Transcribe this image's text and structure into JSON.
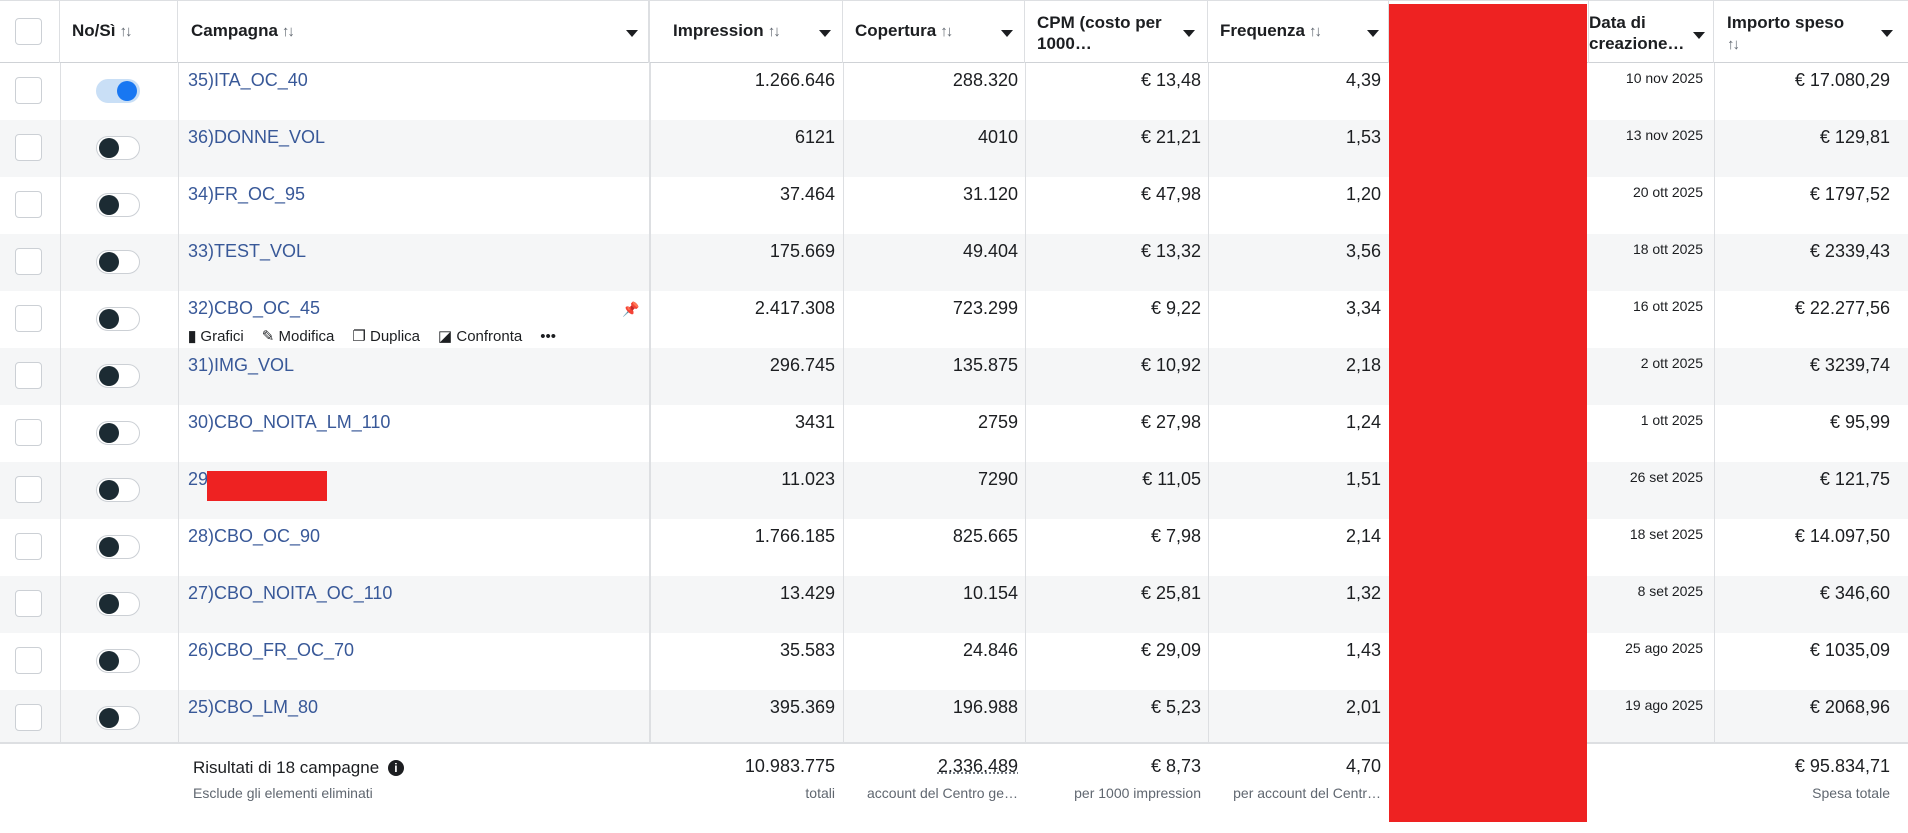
{
  "header": {
    "col_toggle": "No/Sì",
    "col_campaign": "Campagna",
    "col_impressions": "Impression",
    "col_reach": "Copertura",
    "col_cpm": "CPM (costo per 1000…",
    "col_frequency": "Frequenza",
    "col_date": "Data di creazione…",
    "col_spent": "Importo speso",
    "sort_glyph": "↑↓"
  },
  "row_actions": {
    "charts": "Grafici",
    "edit": "Modifica",
    "duplicate": "Duplica",
    "compare": "Confronta",
    "more": "•••"
  },
  "rows": [
    {
      "name": "35)ITA_OC_40",
      "on": true,
      "impressions": "1.266.646",
      "reach": "288.320",
      "cpm": "€ 13,48",
      "frequency": "4,39",
      "date": "10 nov 2025",
      "spent": "€ 17.080,29"
    },
    {
      "name": "36)DONNE_VOL",
      "on": false,
      "impressions": "6121",
      "reach": "4010",
      "cpm": "€ 21,21",
      "frequency": "1,53",
      "date": "13 nov 2025",
      "spent": "€ 129,81"
    },
    {
      "name": "34)FR_OC_95",
      "on": false,
      "impressions": "37.464",
      "reach": "31.120",
      "cpm": "€ 47,98",
      "frequency": "1,20",
      "date": "20 ott 2025",
      "spent": "€ 1797,52"
    },
    {
      "name": "33)TEST_VOL",
      "on": false,
      "impressions": "175.669",
      "reach": "49.404",
      "cpm": "€ 13,32",
      "frequency": "3,56",
      "date": "18 ott 2025",
      "spent": "€ 2339,43"
    },
    {
      "name": "32)CBO_OC_45",
      "on": false,
      "impressions": "2.417.308",
      "reach": "723.299",
      "cpm": "€ 9,22",
      "frequency": "3,34",
      "date": "16 ott 2025",
      "spent": "€ 22.277,56"
    },
    {
      "name": "31)IMG_VOL",
      "on": false,
      "impressions": "296.745",
      "reach": "135.875",
      "cpm": "€ 10,92",
      "frequency": "2,18",
      "date": "2 ott 2025",
      "spent": "€ 3239,74"
    },
    {
      "name": "30)CBO_NOITA_LM_110",
      "on": false,
      "impressions": "3431",
      "reach": "2759",
      "cpm": "€ 27,98",
      "frequency": "1,24",
      "date": "1 ott 2025",
      "spent": "€ 95,99"
    },
    {
      "name": "29",
      "on": false,
      "impressions": "11.023",
      "reach": "7290",
      "cpm": "€ 11,05",
      "frequency": "1,51",
      "date": "26 set 2025",
      "spent": "€ 121,75"
    },
    {
      "name": "28)CBO_OC_90",
      "on": false,
      "impressions": "1.766.185",
      "reach": "825.665",
      "cpm": "€ 7,98",
      "frequency": "2,14",
      "date": "18 set 2025",
      "spent": "€ 14.097,50"
    },
    {
      "name": "27)CBO_NOITA_OC_110",
      "on": false,
      "impressions": "13.429",
      "reach": "10.154",
      "cpm": "€ 25,81",
      "frequency": "1,32",
      "date": "8 set 2025",
      "spent": "€ 346,60"
    },
    {
      "name": "26)CBO_FR_OC_70",
      "on": false,
      "impressions": "35.583",
      "reach": "24.846",
      "cpm": "€ 29,09",
      "frequency": "1,43",
      "date": "25 ago 2025",
      "spent": "€ 1035,09"
    },
    {
      "name": "25)CBO_LM_80",
      "on": false,
      "impressions": "395.369",
      "reach": "196.988",
      "cpm": "€ 5,23",
      "frequency": "2,01",
      "date": "19 ago 2025",
      "spent": "€ 2068,96"
    }
  ],
  "footer": {
    "title": "Risultati di 18 campagne",
    "info_icon": "i",
    "subtitle": "Esclude gli elementi eliminati",
    "impressions": "10.983.775",
    "impressions_sub": "totali",
    "reach": "2.336.489",
    "reach_sub": "account del Centro ge…",
    "cpm": "€ 8,73",
    "cpm_sub": "per 1000 impression",
    "frequency": "4,70",
    "frequency_sub": "per account del Centr…",
    "spent": "€ 95.834,71",
    "spent_sub": "Spesa totale"
  },
  "colors": {
    "link": "#385898",
    "redaction": "#ee2222",
    "toggle_on": "#1877f2",
    "alt_row": "#f5f6f7"
  }
}
